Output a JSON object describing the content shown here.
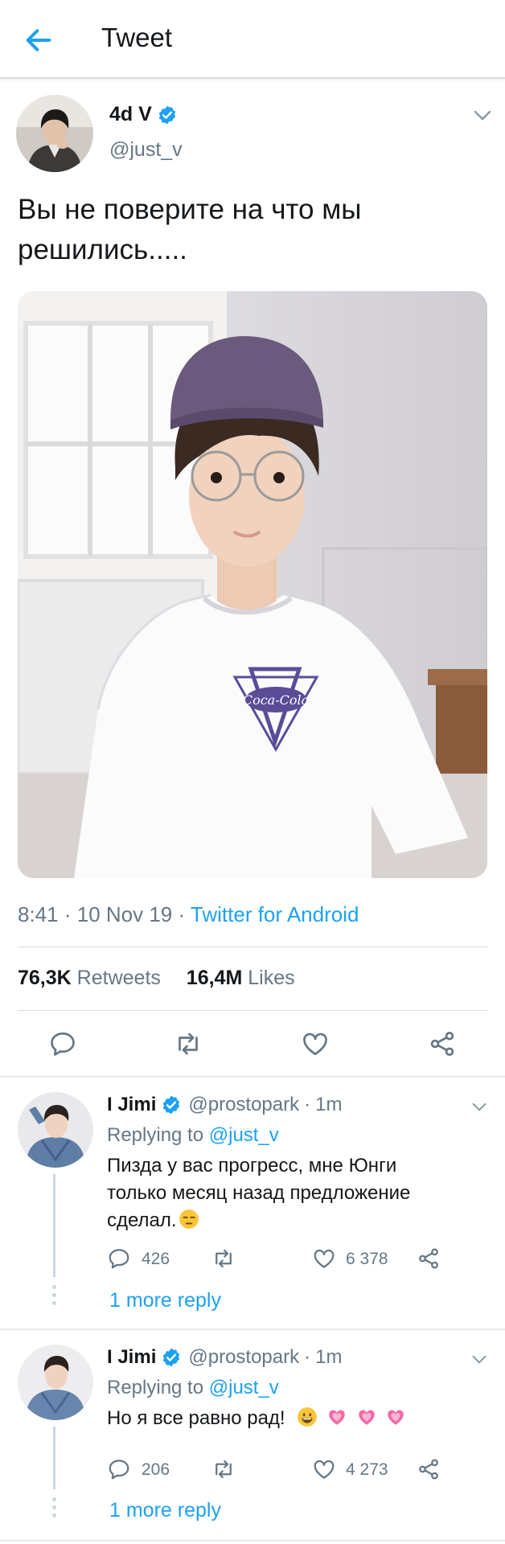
{
  "header": {
    "title": "Tweet",
    "back_icon": "arrow-left-icon",
    "accent": "#1da1f2"
  },
  "tweet": {
    "author_name": "4d V",
    "author_handle": "@just_v",
    "text_line1": "Вы не поверите на что мы",
    "text_line2": "решились.....",
    "time": "8:41",
    "date": "10 Nov 19",
    "source": "Twitter for Android",
    "retweets_count": "76,3K",
    "retweets_label": "Retweets",
    "likes_count": "16,4M",
    "likes_label": "Likes",
    "media_shirt_text": "Coca-Cola"
  },
  "actions": [
    "reply-icon",
    "retweet-icon",
    "like-icon",
    "share-icon"
  ],
  "replies": [
    {
      "name": "I Jimi",
      "handle": "@prostopark",
      "time": "1m",
      "replying_prefix": "Replying to",
      "replying_to": "@just_v",
      "line1": "Пизда у вас прогресс, мне Юнги",
      "line2": "только месяц назад предложение",
      "line3": "сделал.",
      "reply_count": "426",
      "retweet_count": "",
      "like_count": "6 378",
      "more": "1 more reply"
    },
    {
      "name": "I Jimi",
      "handle": "@prostopark",
      "time": "1m",
      "replying_prefix": "Replying to",
      "replying_to": "@just_v",
      "line1": "Но я все равно рад!",
      "reply_count": "206",
      "retweet_count": "",
      "like_count": "4 273",
      "more": "1 more reply"
    }
  ]
}
